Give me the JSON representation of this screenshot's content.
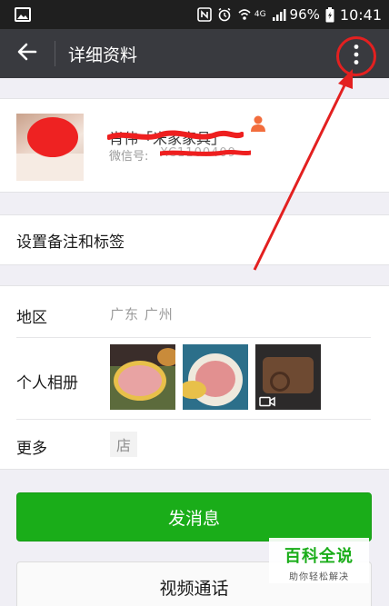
{
  "status_bar": {
    "battery_percent": "96%",
    "time": "10:41",
    "network_label": "4G"
  },
  "title_bar": {
    "title": "详细资料",
    "back_icon": "arrow-left-icon",
    "more_icon": "more-vertical-icon"
  },
  "profile": {
    "display_name": "肖伟「米家家具」",
    "wechat_id_label": "微信号:",
    "wechat_id_value": "XC1100409",
    "gender_icon": "person-icon"
  },
  "remark_row": {
    "label": "设置备注和标签"
  },
  "info": {
    "region_label": "地区",
    "region_value": "广东  广州",
    "album_label": "个人相册",
    "more_label": "更多",
    "store_badge": "店"
  },
  "actions": {
    "send_message": "发消息",
    "video_call": "视频通话"
  },
  "watermark": {
    "title": "百科全说",
    "subtitle": "助你轻松解决"
  },
  "colors": {
    "title_bar_bg": "#393a3f",
    "accent_green": "#1aad19",
    "annotation_red": "#e32020"
  }
}
